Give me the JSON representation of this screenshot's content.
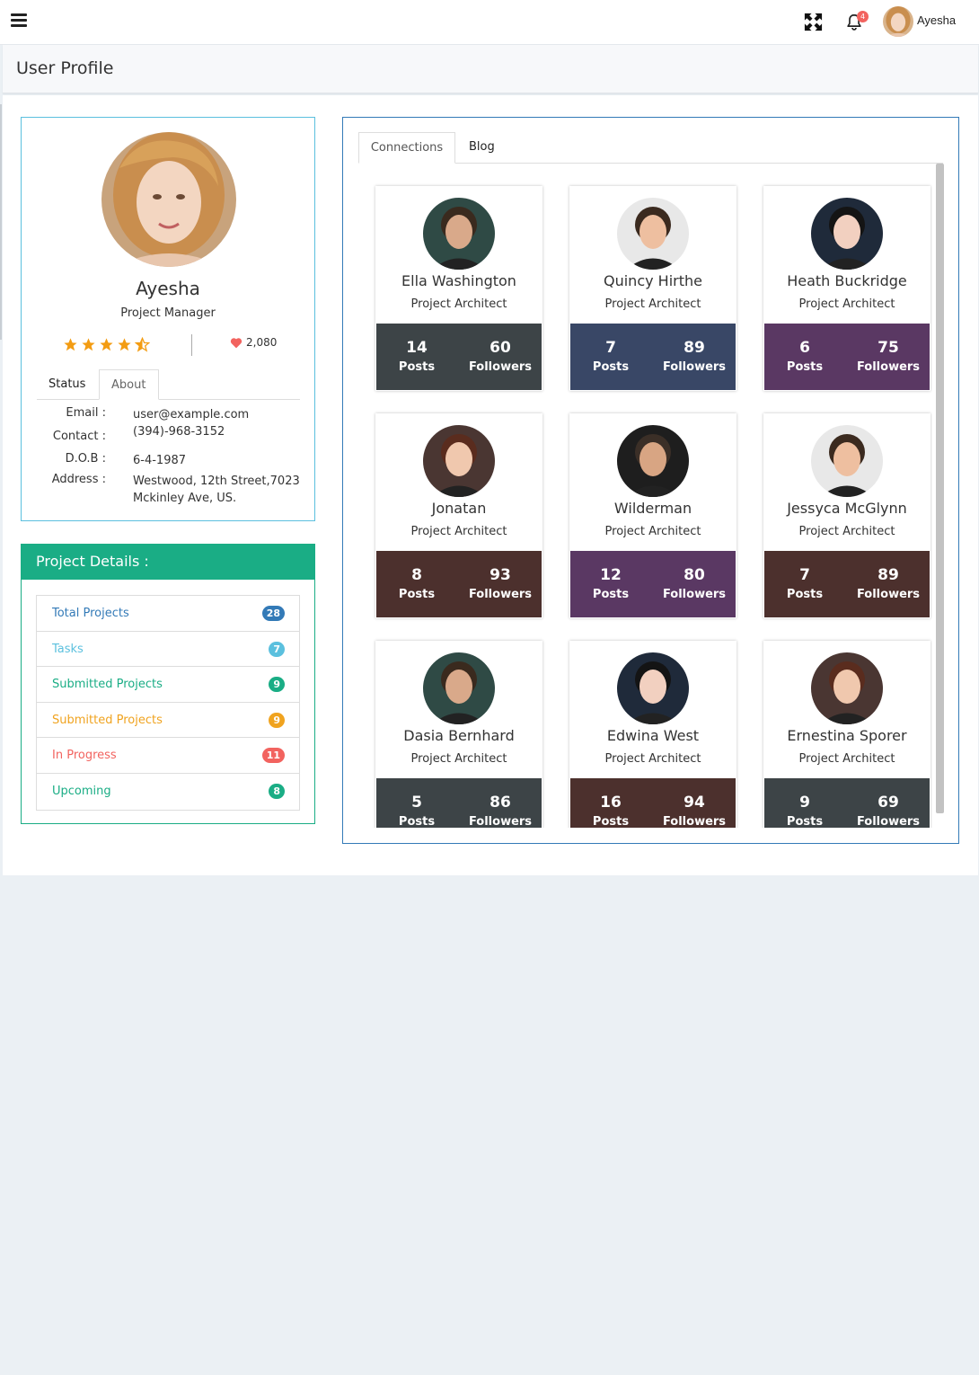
{
  "topbar": {
    "notification_count": "4",
    "user_name": "Ayesha"
  },
  "page": {
    "title": "User Profile"
  },
  "profile": {
    "name": "Ayesha",
    "role": "Project Manager",
    "rating": 4.5,
    "likes": "2,080",
    "tabs": [
      "Status",
      "About"
    ],
    "active_tab": "About",
    "info": [
      {
        "label": "Email :",
        "value": "user@example.com"
      },
      {
        "label": "Contact :",
        "value": "(394)-968-3152"
      },
      {
        "label": "D.O.B :",
        "value": "6-4-1987"
      },
      {
        "label": "Address :",
        "value": "Westwood, 12th Street,7023 Mckinley Ave, US."
      }
    ]
  },
  "projects": {
    "title": "Project Details :",
    "items": [
      {
        "label": "Total Projects",
        "count": "28",
        "color": "#337ab7"
      },
      {
        "label": "Tasks",
        "count": "7",
        "color": "#5bc0de"
      },
      {
        "label": "Submitted Projects",
        "count": "9",
        "color": "#1aad85"
      },
      {
        "label": "Submitted Projects",
        "count": "9",
        "color": "#f0a31f"
      },
      {
        "label": "In Progress",
        "count": "11",
        "color": "#f2635f"
      },
      {
        "label": "Upcoming",
        "count": "8",
        "color": "#1aad85"
      }
    ]
  },
  "connections": {
    "tabs": [
      "Connections",
      "Blog"
    ],
    "active_tab": "Connections",
    "stat_labels": {
      "posts": "Posts",
      "followers": "Followers"
    },
    "members": [
      {
        "name": "Ella Washington",
        "role": "Project Architect",
        "posts": "14",
        "followers": "60",
        "color": "#3d4447"
      },
      {
        "name": "Quincy Hirthe",
        "role": "Project Architect",
        "posts": "7",
        "followers": "89",
        "color": "#394766"
      },
      {
        "name": "Heath Buckridge",
        "role": "Project Architect",
        "posts": "6",
        "followers": "75",
        "color": "#5a3863"
      },
      {
        "name": "Jonatan",
        "role": "Project Architect",
        "posts": "8",
        "followers": "93",
        "color": "#4c302d"
      },
      {
        "name": "Wilderman",
        "role": "Project Architect",
        "posts": "12",
        "followers": "80",
        "color": "#5a3863"
      },
      {
        "name": "Jessyca McGlynn",
        "role": "Project Architect",
        "posts": "7",
        "followers": "89",
        "color": "#4c302d"
      },
      {
        "name": "Dasia Bernhard",
        "role": "Project Architect",
        "posts": "5",
        "followers": "86",
        "color": "#3d4447"
      },
      {
        "name": "Edwina West",
        "role": "Project Architect",
        "posts": "16",
        "followers": "94",
        "color": "#4c302d"
      },
      {
        "name": "Ernestina Sporer",
        "role": "Project Architect",
        "posts": "9",
        "followers": "69",
        "color": "#3d4447"
      }
    ]
  },
  "colors": {
    "primary": "#337ab7",
    "info": "#5bc0de",
    "success": "#1aad85",
    "warning": "#f0a31f",
    "danger": "#f2635f",
    "star": "#f39c12"
  }
}
